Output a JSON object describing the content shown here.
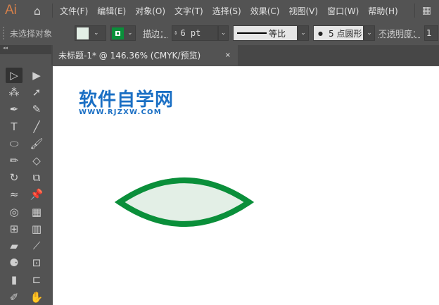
{
  "app": {
    "logo": "Ai"
  },
  "menu": [
    "文件(F)",
    "编辑(E)",
    "对象(O)",
    "文字(T)",
    "选择(S)",
    "效果(C)",
    "视图(V)",
    "窗口(W)",
    "帮助(H)"
  ],
  "control": {
    "selection": "未选择对象",
    "stroke_label": "描边：",
    "stroke_value": "6 pt",
    "profile_label": "等比",
    "brush_label": "5 点圆形",
    "opacity_label": "不透明度：",
    "opacity_value": "1",
    "fill_color": "#e3efe6",
    "stroke_color": "#0a8f3a"
  },
  "tab": {
    "title": "未标题-1* @ 146.36% (CMYK/预览)",
    "close": "×"
  },
  "canvas": {
    "logo_cn": "软件自学网",
    "logo_url": "WWW.RJZXW.COM",
    "shape_fill": "#e3efe6",
    "shape_stroke": "#0a8f3a"
  },
  "tools": [
    [
      "selection-tool",
      "▷"
    ],
    [
      "direct-selection-tool",
      "▶"
    ],
    [
      "magic-wand-tool",
      "⁂"
    ],
    [
      "lasso-tool",
      "➚"
    ],
    [
      "pen-tool",
      "✒"
    ],
    [
      "curvature-tool",
      "✎"
    ],
    [
      "type-tool",
      "T"
    ],
    [
      "line-tool",
      "╱"
    ],
    [
      "ellipse-tool",
      "⬭"
    ],
    [
      "paintbrush-tool",
      "🖌"
    ],
    [
      "pencil-tool",
      "✏"
    ],
    [
      "eraser-tool",
      "◇"
    ],
    [
      "rotate-tool",
      "↻"
    ],
    [
      "scale-tool",
      "⧉"
    ],
    [
      "warp-tool",
      "≈"
    ],
    [
      "pin-tool",
      "📌"
    ],
    [
      "shape-builder-tool",
      "◎"
    ],
    [
      "perspective-grid-tool",
      "▦"
    ],
    [
      "mesh-tool",
      "⊞"
    ],
    [
      "gradient-tool",
      "▥"
    ],
    [
      "measure-tool",
      "▰"
    ],
    [
      "eyedropper-tool",
      "⟋"
    ],
    [
      "blend-tool",
      "⚈"
    ],
    [
      "symbol-sprayer-tool",
      "⊡"
    ],
    [
      "graph-tool",
      "▮"
    ],
    [
      "artboard-tool",
      "⊏"
    ],
    [
      "slice-tool",
      "✐"
    ],
    [
      "hand-tool",
      "✋"
    ]
  ]
}
